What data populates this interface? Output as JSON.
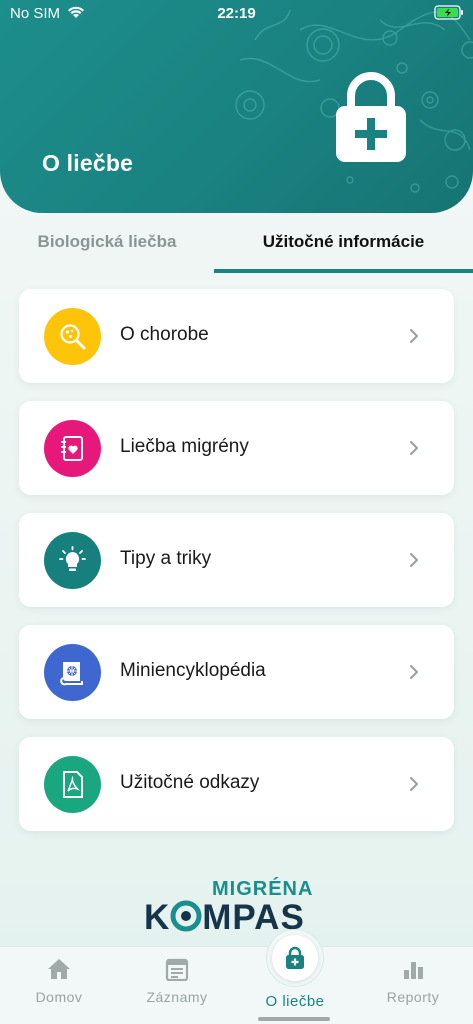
{
  "status_bar": {
    "carrier": "No SIM",
    "time": "22:19"
  },
  "header": {
    "title": "O liečbe",
    "icon": "lock-plus-icon",
    "background_color": "#1a8281"
  },
  "tabs": [
    {
      "label": "Biologická liečba",
      "active": false
    },
    {
      "label": "Užitočné informácie",
      "active": true
    }
  ],
  "menu": [
    {
      "label": "O chorobe",
      "icon": "magnifier-virus-icon",
      "color": "#fdc40a"
    },
    {
      "label": "Liečba migrény",
      "icon": "notebook-heart-icon",
      "color": "#e6197a"
    },
    {
      "label": "Tipy a triky",
      "icon": "lightbulb-icon",
      "color": "#17807e"
    },
    {
      "label": "Miniencyklopédia",
      "icon": "book-globe-icon",
      "color": "#3e67d0"
    },
    {
      "label": "Užitočné odkazy",
      "icon": "pdf-document-icon",
      "color": "#1aa67e"
    }
  ],
  "logo": {
    "top": "MIGRÉNA",
    "bottom_k": "K",
    "bottom_rest": "MPAS"
  },
  "bottom_nav": [
    {
      "label": "Domov",
      "icon": "home-icon"
    },
    {
      "label": "Záznamy",
      "icon": "calendar-icon"
    },
    {
      "label": "O liečbe",
      "icon": "lock-plus-icon",
      "active": true
    },
    {
      "label": "Reporty",
      "icon": "bar-chart-icon"
    }
  ]
}
